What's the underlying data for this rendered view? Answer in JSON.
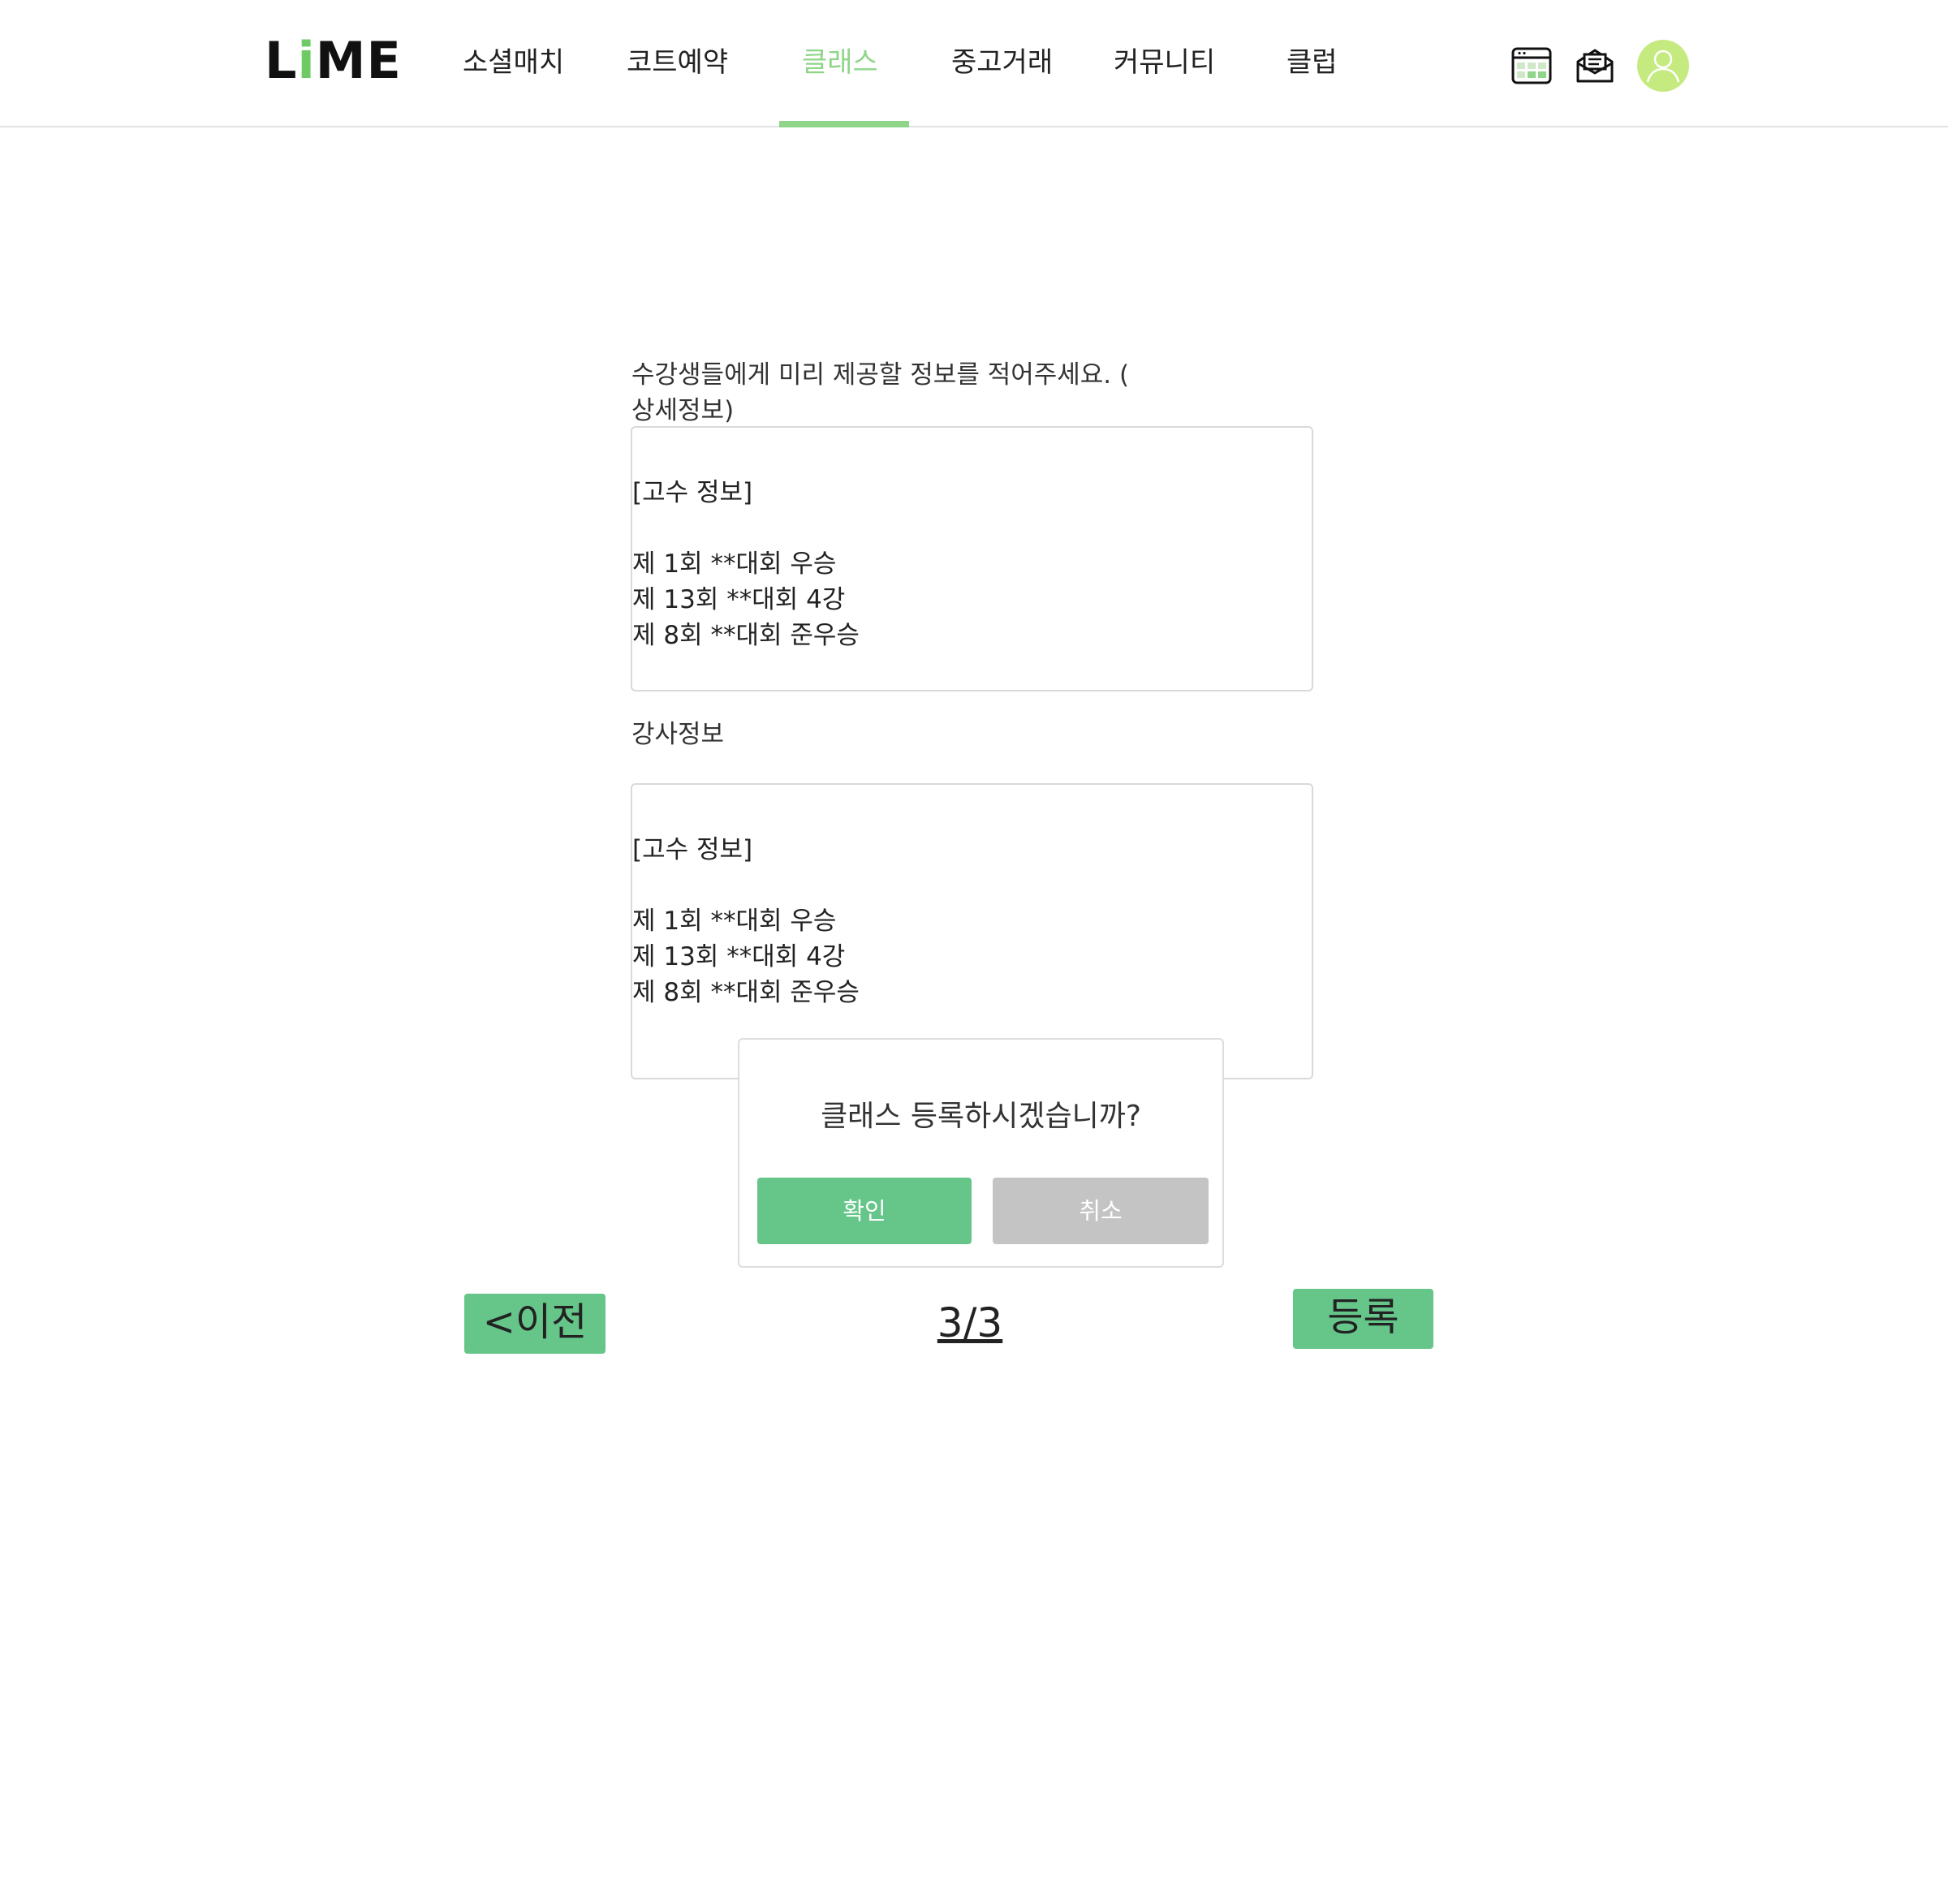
{
  "header": {
    "logo": {
      "prefix": "L",
      "highlight": "i",
      "suffix": "ME"
    },
    "nav": [
      {
        "label": "소셜매치",
        "active": false
      },
      {
        "label": "코트예약",
        "active": false
      },
      {
        "label": "클래스",
        "active": true
      },
      {
        "label": "중고거래",
        "active": false
      },
      {
        "label": "커뮤니티",
        "active": false
      },
      {
        "label": "클럽",
        "active": false
      }
    ],
    "icons": [
      "calendar-icon",
      "mail-icon",
      "avatar-icon"
    ]
  },
  "form": {
    "detail_label": "수강생들에게 미리 제공할 정보를 적어주세요. (\n상세정보)",
    "detail_value": "[고수 정보]\n\n제 1회 **대회 우승\n제 13회 **대회 4강\n제 8회 **대회 준우승",
    "instructor_label": "강사정보",
    "instructor_value": "[고수 정보]\n\n제 1회 **대회 우승\n제 13회 **대회 4강\n제 8회 **대회 준우승"
  },
  "footer": {
    "prev_label": "<이전",
    "page_indicator": "3/3",
    "submit_label": "등록"
  },
  "dialog": {
    "message": "클래스 등록하시겠습니까?",
    "confirm_label": "확인",
    "cancel_label": "취소"
  },
  "colors": {
    "accent": "#8fd58a",
    "button": "#66c68a",
    "cancel": "#c4c4c4",
    "avatar": "#c5ea7f"
  }
}
